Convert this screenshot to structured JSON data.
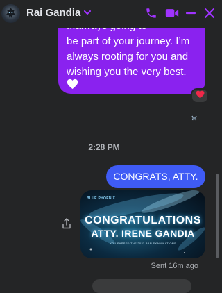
{
  "header": {
    "contact_name": "Rai Gandia",
    "colors": {
      "accent": "#a033ff",
      "background": "#242526"
    }
  },
  "thread": {
    "outgoing_long_message": {
      "cut_line": "...always going to",
      "lines": [
        "be part of your journey. I’m",
        "always rooting for you and",
        "wishing you the very best."
      ],
      "emoji": "white-heart",
      "color": "#8a22ef",
      "reaction": "red-heart"
    },
    "timestamp": "2:28 PM",
    "outgoing_short_message": {
      "text": "CONGRATS, ATTY.",
      "color": "#3f5bf5"
    },
    "image_card": {
      "brand": "BLUE PHOENIX",
      "line1": "CONGRATULATIONS",
      "line2": "ATTY. IRENE GANDIA",
      "subtitle": "YOU PASSED THE 2023 BAR EXAMINATIONS"
    },
    "status": "Sent 16m ago"
  }
}
